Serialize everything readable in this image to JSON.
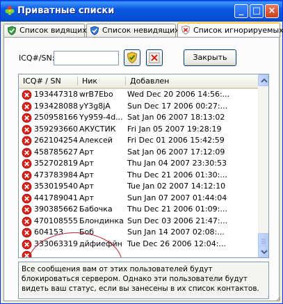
{
  "window": {
    "title": "Приватные списки",
    "minimize_glyph": "_",
    "maximize_glyph": "□",
    "close_glyph": "×"
  },
  "tabs": [
    {
      "label": "Список видящих",
      "icon": "green-check-shield-icon"
    },
    {
      "label": "Список невидящих",
      "icon": "blue-check-shield-icon"
    },
    {
      "label": "Список игнорируемых",
      "icon": "red-x-shield-icon",
      "active": true
    }
  ],
  "toolbar": {
    "icq_label": "ICQ#/SN:",
    "icq_value": "",
    "close_label": "Закрыть"
  },
  "list": {
    "columns": [
      "ICQ# / SN",
      "Ник",
      "Добавлен"
    ],
    "rows": [
      [
        "193447318",
        "wrB7Ebo",
        "Wed Dec 20 2006 14:56:..."
      ],
      [
        "193428088",
        "yY3g8jA",
        "Sun Dec 17 2006 00:27:..."
      ],
      [
        "250958166",
        "Yy959-4d...",
        "Sat Jan 06 2007 18:13:02"
      ],
      [
        "359293660",
        "АКУСТИК",
        "Fri Jan 05 2007 19:28:19"
      ],
      [
        "262104254",
        "Алексей",
        "Fri Dec 01 2006 15:42:59"
      ],
      [
        "458785627",
        "Арт",
        "Sat Jan 06 2007 17:12:09"
      ],
      [
        "352702819",
        "Арт",
        "Thu Jan 04 2007 23:30:53"
      ],
      [
        "473783984",
        "Арт",
        "Thu Dec 21 2006 01:30:..."
      ],
      [
        "353019540",
        "Арт",
        "Tue Jan 02 2007 14:12:10"
      ],
      [
        "441789041",
        "Арт",
        "Sun Jan 07 2007 01:44:04"
      ],
      [
        "390385662",
        "Бабочка",
        "Thu Dec 21 2006 01:09:..."
      ],
      [
        "470108555",
        "Блондинка",
        "Sun Dec 03 2006 21:47:..."
      ],
      [
        "604153",
        "Боб",
        "Sun Jan 14 2007 02:08:..."
      ],
      [
        "333063319",
        "дйфиефйн",
        "Tue Dec 26 2006 12:04:..."
      ],
      [
        "",
        "",
        ""
      ]
    ]
  },
  "note": "Все сообщения вам от этих пользователей будут блокироваться сервером. Однако эти пользователи будут видеть ваш статус, если вы занесены в их список контактов.",
  "colors": {
    "title_bar": "#0a58e0",
    "tab_highlight": "#ffc83c",
    "annotation_circle": "#c0202a",
    "ignore_icon": "#d8241c"
  }
}
